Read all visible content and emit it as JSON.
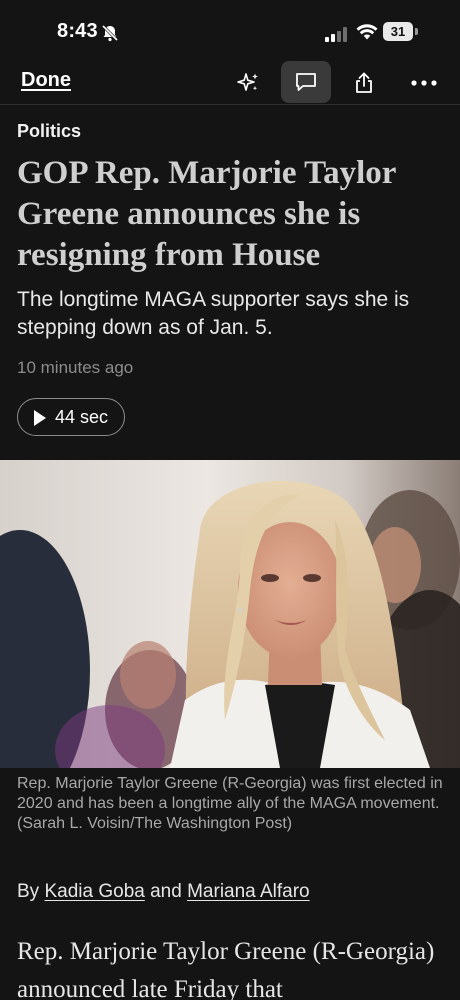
{
  "status_bar": {
    "time": "8:43",
    "battery": "31"
  },
  "toolbar": {
    "done_label": "Done",
    "icons": [
      "sparkle-icon",
      "comment-icon",
      "share-icon",
      "more-icon"
    ]
  },
  "article": {
    "section": "Politics",
    "headline": "GOP Rep. Marjorie Taylor Greene announces she is resigning from House",
    "dek": "The longtime MAGA supporter says she is stepping down as of Jan. 5.",
    "timestamp": "10 minutes ago",
    "audio_duration": "44 sec",
    "photo_caption": "Rep. Marjorie Taylor Greene (R-Georgia) was first elected in 2020 and has been a longtime ally of the MAGA movement. (Sarah L. Voisin/The Washington Post)",
    "byline_prefix": "By",
    "byline_connector": "and",
    "authors": [
      "Kadia Goba",
      "Mariana Alfaro"
    ],
    "body_start": "Rep. Marjorie Taylor Greene (R-Georgia) announced late Friday that"
  },
  "colors": {
    "background": "#141414",
    "text_primary": "#f2f2f2",
    "headline": "#cfcfcf",
    "muted": "#8c8c8c",
    "active_button_bg": "#3a3a3a"
  }
}
